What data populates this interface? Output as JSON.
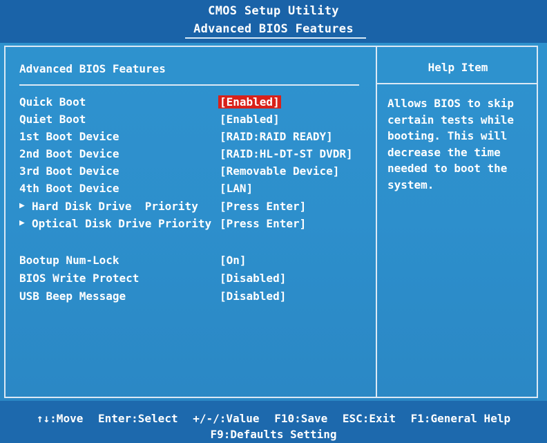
{
  "header": {
    "title": "CMOS Setup Utility",
    "subtitle": "Advanced BIOS Features"
  },
  "main": {
    "section_title": "Advanced BIOS Features",
    "settings": [
      {
        "label": "Quick Boot",
        "value": "[Enabled]",
        "selected": true
      },
      {
        "label": "Quiet Boot",
        "value": "[Enabled]"
      },
      {
        "label": "1st Boot Device",
        "value": "[RAID:RAID READY]"
      },
      {
        "label": "2nd Boot Device",
        "value": "[RAID:HL-DT-ST DVDR]"
      },
      {
        "label": "3rd Boot Device",
        "value": "[Removable Device]"
      },
      {
        "label": "4th Boot Device",
        "value": "[LAN]"
      },
      {
        "label": "Hard Disk Drive  Priority",
        "value": "[Press Enter]",
        "submenu": true
      },
      {
        "label": "Optical Disk Drive Priority",
        "value": "[Press Enter]",
        "submenu": true
      },
      {
        "label": "Bootup Num-Lock",
        "value": "[On]"
      },
      {
        "label": "BIOS Write Protect",
        "value": "[Disabled]"
      },
      {
        "label": "USB Beep Message",
        "value": "[Disabled]"
      }
    ]
  },
  "help": {
    "title": "Help Item",
    "lines": [
      "Allows BIOS to skip",
      "certain tests while",
      "booting. This will",
      "decrease the time",
      "needed to boot the",
      "system."
    ]
  },
  "footer": {
    "keys": [
      "↑↓:Move",
      "Enter:Select",
      "+/-/:Value",
      "F10:Save",
      "ESC:Exit",
      "F1:General Help"
    ],
    "line2": "F9:Defaults Setting"
  },
  "icons": {
    "submenu_arrow": "▶"
  }
}
